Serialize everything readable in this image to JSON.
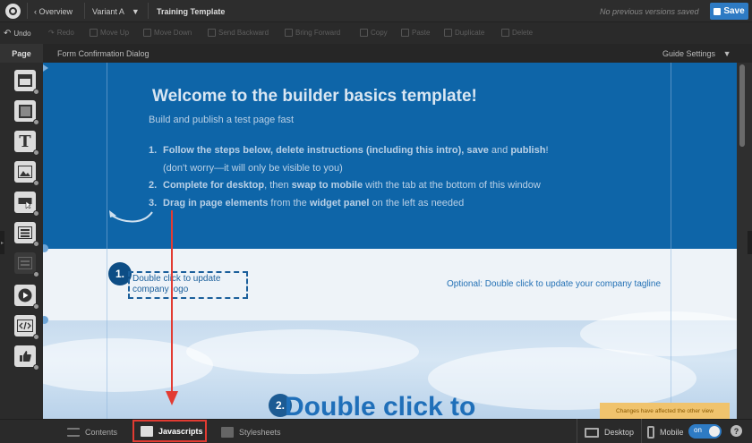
{
  "topbar": {
    "overview_label": "Overview",
    "variant_label": "Variant A",
    "template_name": "Training Template",
    "versions_status": "No previous versions saved",
    "save_label": "Save"
  },
  "toolbar": {
    "tools": [
      "Undo",
      "Redo",
      "Move Up",
      "Move Down",
      "Send Backward",
      "Bring Forward",
      "Copy",
      "Paste",
      "Duplicate",
      "Delete"
    ]
  },
  "header": {
    "page_tab": "Page",
    "dialog_name": "Form Confirmation Dialog",
    "guide_settings": "Guide Settings"
  },
  "hero": {
    "title": "Welcome to the builder basics template!",
    "subtitle": "Build and publish a test page fast",
    "steps": [
      {
        "num": "1.",
        "b1": "Follow the steps below, delete instructions (including this intro), save",
        "t1": " and ",
        "b2": "publish",
        "t2": "!"
      },
      {
        "num": "",
        "b1": "",
        "t1": "(don't worry—it will only be visible to you)",
        "b2": "",
        "t2": ""
      },
      {
        "num": "2.",
        "b1": "Complete for desktop",
        "t1": ", then ",
        "b2": "swap to mobile",
        "t2": " with the tab at the bottom of this window"
      },
      {
        "num": "3.",
        "b1": "Drag in page elements",
        "t1": " from the ",
        "b2": "widget panel",
        "t2": " on the left as needed"
      }
    ]
  },
  "logo_row": {
    "badge": "1.",
    "logo_placeholder": "Double click to update company logo",
    "tagline": "Optional: Double click to update your company tagline"
  },
  "sky": {
    "badge": "2.",
    "headline": "Double click to"
  },
  "notice": "Changes have affected the other view",
  "bottombar": {
    "contents": "Contents",
    "javascripts": "Javascripts",
    "stylesheets": "Stylesheets",
    "desktop": "Desktop",
    "mobile": "Mobile",
    "toggle": "on",
    "help": "?"
  },
  "colors": {
    "hero_bg": "#0e65a8",
    "save_button": "#2e7bc4",
    "highlight_box": "#e23b32",
    "notice_bg": "#f0c36d"
  }
}
